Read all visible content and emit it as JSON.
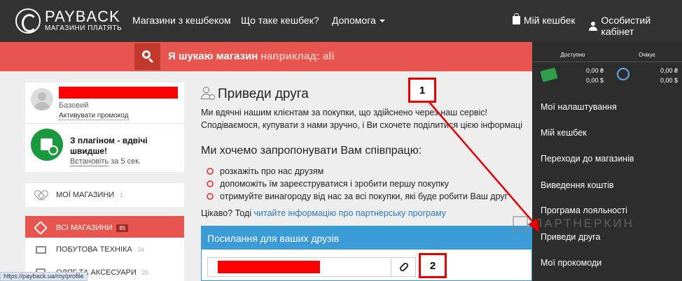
{
  "brand": {
    "name": "PAYBACK",
    "tagline": "МАГАЗИНИ ПЛАТЯТЬ"
  },
  "nav": {
    "items": [
      "Магазини з кешбеком",
      "Що таке кешбек?",
      "Допомога"
    ],
    "my_cashback": "Мій кешбек",
    "cabinet": "Особистий кабінет"
  },
  "search": {
    "label": "Я шукаю магазин",
    "placeholder": "наприклад: ali"
  },
  "profile": {
    "level": "Базовий",
    "promo_link": "Активувати промокод"
  },
  "plugin": {
    "title": "З плагіном - вдвічі швидше!",
    "install": "Встановіть",
    "duration": "за 5 сек."
  },
  "left_menu": [
    {
      "label": "МОЇ МАГАЗИНИ",
      "count": "1"
    },
    {
      "label": "ВСІ МАГАЗИНИ",
      "count": "85"
    },
    {
      "label": "ПОБУТОВА ТЕХНІКА",
      "count": "24"
    },
    {
      "label": "ОДЯГ ТА АКСЕСУАРИ",
      "count": "20"
    }
  ],
  "status_url": "https://payback.ua/my/profile",
  "main": {
    "title": "Приведи друга",
    "intro_1": "Ми вдячні нашим клієнтам за покупки, що здійснено через наш сервіс!",
    "intro_2": "Сподіваємося, купувати з нами зручно, і Ви схочете поділитися цією інформаці",
    "offer_title": "Ми хочемо запропонувати Вам співпрацю:",
    "bullets": [
      "розкажіть про нас друзям",
      "допоможіть їм зареєструватися і зробити першу покупку",
      "отримуйте винагороду від нас за всі покупки, які буде робити Ваш друг"
    ],
    "partner_prefix": "Цікаво? Тоді",
    "partner_link": "читайте інформацію про партнерську програму",
    "links_panel_title": "Посилання для ваших друзів"
  },
  "sidebar": {
    "available_label": "Доступно",
    "pending_label": "Очікує",
    "available_uah": "0,00 ₴",
    "available_usd": "0,00 $",
    "pending_uah": "0,00 ₴",
    "pending_usd": "0,00 $",
    "items": [
      "Мої налаштування",
      "Мій кешбек",
      "Переходи до магазинів",
      "Виведення коштів",
      "Програма лояльності",
      "Приведи друга",
      "Мої прокомоди"
    ]
  },
  "watermark": "ПАРТНЕРКИН",
  "annotations": {
    "step1": "1",
    "step2": "2"
  },
  "colors": {
    "accent_red": "#e8554e",
    "panel_blue": "#3a9bd6",
    "dark": "#333333",
    "annotation_red": "#e60000"
  }
}
